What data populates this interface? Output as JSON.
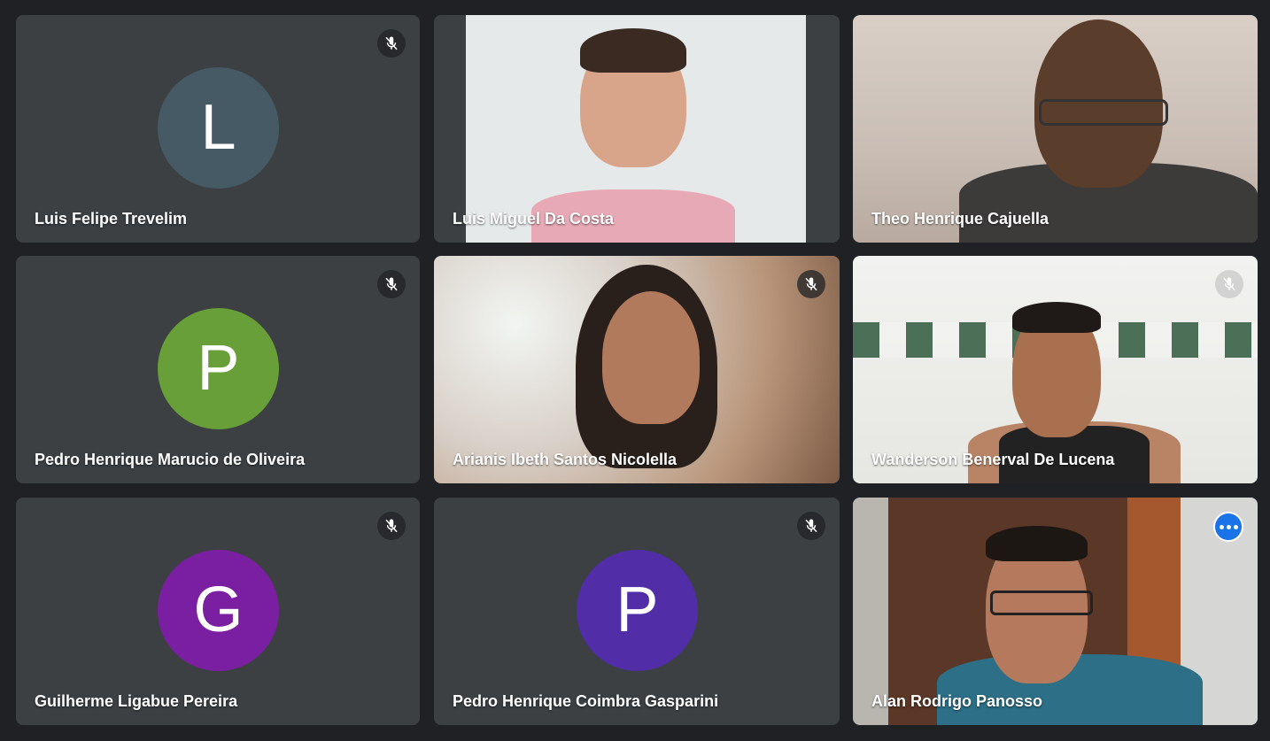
{
  "participants": [
    {
      "name": "Luis Felipe Trevelim",
      "initial": "L",
      "avatar_color": "#455a64",
      "muted": true,
      "video": false
    },
    {
      "name": "Luis Miguel Da Costa",
      "muted": false,
      "video": true
    },
    {
      "name": "Theo Henrique Cajuella",
      "muted": false,
      "video": true
    },
    {
      "name": "Pedro Henrique Marucio de Oliveira",
      "initial": "P",
      "avatar_color": "#689f38",
      "muted": true,
      "video": false
    },
    {
      "name": "Arianis Ibeth Santos Nicolella",
      "muted": true,
      "video": true
    },
    {
      "name": "Wanderson Benerval De Lucena",
      "muted": true,
      "video": true
    },
    {
      "name": "Guilherme Ligabue Pereira",
      "initial": "G",
      "avatar_color": "#7b1fa2",
      "muted": true,
      "video": false
    },
    {
      "name": "Pedro Henrique Coimbra Gasparini",
      "initial": "P",
      "avatar_color": "#512da8",
      "muted": true,
      "video": false
    },
    {
      "name": "Alan Rodrigo Panosso",
      "muted": false,
      "video": true,
      "active_speaker": true
    }
  ],
  "icons": {
    "muted": "mic-off-icon",
    "more": "more-options-icon"
  },
  "colors": {
    "background": "#202124",
    "tile": "#3c4043",
    "accent": "#1a73e8",
    "active_border": "#8ab4f8"
  }
}
